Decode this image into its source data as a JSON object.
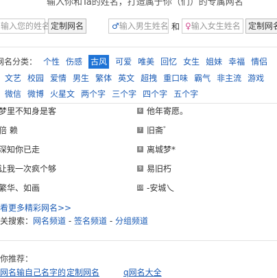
{
  "header": {
    "tagline": "输入你和Ta的姓名，打造属于你（们）的专属网名"
  },
  "form": {
    "name_placeholder": "输入您的姓名",
    "custom_button": "定制网名",
    "male_placeholder": "输入男生姓名",
    "and_text": "和",
    "female_placeholder": "输入女生姓名",
    "couple_button": "定制网名"
  },
  "categories": {
    "label": "网名分类：",
    "row1": [
      "个性",
      "伤感",
      "古风",
      "可爱",
      "唯美",
      "回忆",
      "女生",
      "姐妹",
      "幸福",
      "情侣"
    ],
    "selected": "古风",
    "row2": [
      "文艺",
      "校园",
      "爱情",
      "男生",
      "繁体",
      "英文",
      "超拽",
      "重口味",
      "霸气",
      "非主流",
      "游戏"
    ],
    "row3": [
      "微信",
      "微博",
      "火星文",
      "两个字",
      "三个字",
      "四个字",
      "五个字"
    ]
  },
  "names": {
    "left": [
      "梦里不知身是客",
      "倍 赖",
      "深知你已走",
      "让我一次疯个够",
      "繁华、如画"
    ],
    "right": [
      "他年寄愿。",
      "旧斋゛",
      "离城梦*",
      "易旧朽",
      "-安城乀"
    ],
    "right_icons": [
      "6",
      "7",
      "8",
      "9",
      "10"
    ]
  },
  "more_link": "看更多精彩网名>>",
  "related": {
    "label": "关搜索：",
    "links": [
      "网名频道",
      "签名频道",
      "分组频道"
    ],
    "sep": " - "
  },
  "recommend": {
    "label": "你推荐：",
    "links": [
      "网名输自己名字的",
      "定制网名",
      "q网名大全"
    ]
  }
}
